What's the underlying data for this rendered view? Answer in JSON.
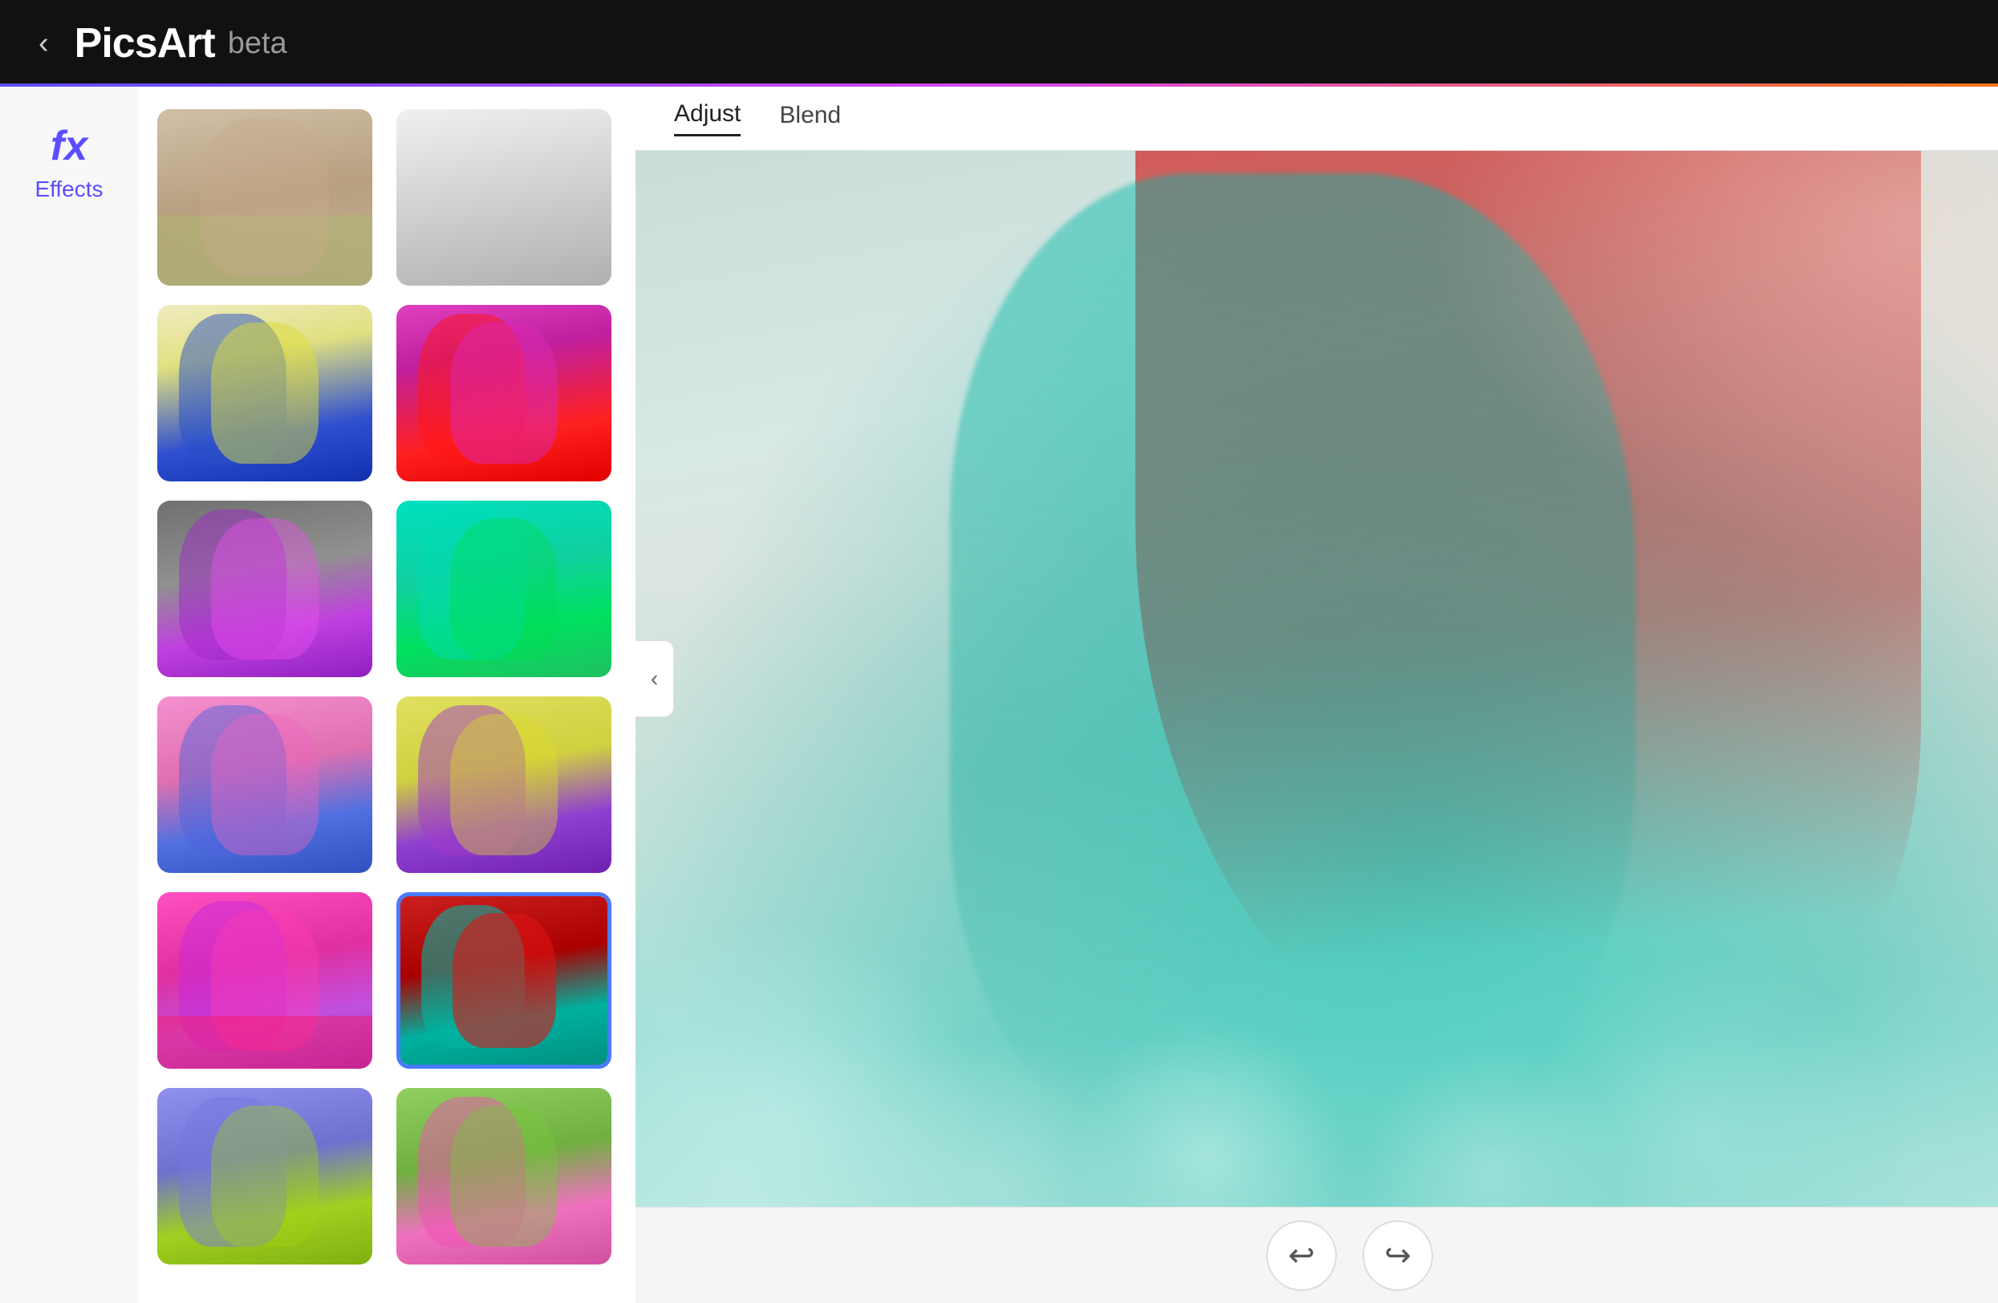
{
  "header": {
    "back_label": "‹",
    "logo": "PicsArt",
    "beta": "beta"
  },
  "sidebar": {
    "fx_icon": "fx",
    "effects_label": "Effects"
  },
  "toolbar": {
    "adjust_label": "Adjust",
    "blend_label": "Blend"
  },
  "thumbnails": [
    {
      "id": "original",
      "style": "original",
      "selected": false
    },
    {
      "id": "bw",
      "style": "bw",
      "selected": false
    },
    {
      "id": "yellow-blue",
      "style": "yellow-blue",
      "selected": false
    },
    {
      "id": "pink-red",
      "style": "pink-red",
      "selected": false
    },
    {
      "id": "gray-purple",
      "style": "gray-purple",
      "selected": false
    },
    {
      "id": "cyan-green",
      "style": "cyan-green",
      "selected": false
    },
    {
      "id": "pink-blue",
      "style": "pink-blue",
      "selected": false
    },
    {
      "id": "yellow-purple",
      "style": "yellow-purple",
      "selected": false
    },
    {
      "id": "pink-magenta",
      "style": "pink-magenta",
      "selected": false
    },
    {
      "id": "red-cyan",
      "style": "red-cyan-selected",
      "selected": true
    },
    {
      "id": "blue-lime",
      "style": "blue-lime",
      "selected": false
    },
    {
      "id": "green-pink",
      "style": "green-pink",
      "selected": false
    }
  ],
  "bottom_toolbar": {
    "undo_label": "↩",
    "redo_label": "↪"
  },
  "collapse_icon": "‹",
  "expand_icon": "›"
}
